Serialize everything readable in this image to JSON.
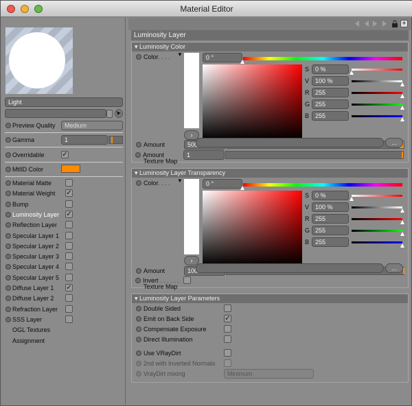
{
  "window": {
    "title": "Material Editor"
  },
  "left": {
    "name": "Light",
    "preview_quality": {
      "label": "Preview Quality",
      "value": "Medium"
    },
    "gamma": {
      "label": "Gamma",
      "value": "1"
    },
    "overridable": {
      "label": "Overridable"
    },
    "mtlid": {
      "label": "MtlID Color",
      "color": "#ff8a00"
    },
    "channels": [
      {
        "label": "Material Matte",
        "checked": false
      },
      {
        "label": "Material Weight",
        "checked": true
      },
      {
        "label": "Bump",
        "checked": false
      },
      {
        "label": "Luminosity Layer",
        "checked": true,
        "active": true
      },
      {
        "label": "Reflection Layer",
        "checked": false
      },
      {
        "label": "Specular Layer 1",
        "checked": false
      },
      {
        "label": "Specular Layer 2",
        "checked": false
      },
      {
        "label": "Specular Layer 3",
        "checked": false
      },
      {
        "label": "Specular Layer 4",
        "checked": false
      },
      {
        "label": "Specular Layer 5",
        "checked": false
      },
      {
        "label": "Diffuse Layer 1",
        "checked": true
      },
      {
        "label": "Diffuse Layer 2",
        "checked": false
      },
      {
        "label": "Refraction Layer",
        "checked": false
      },
      {
        "label": "SSS Layer",
        "checked": false
      }
    ],
    "ogl": "OGL Textures",
    "assignment": "Assignment"
  },
  "right": {
    "title": "Luminosity Layer",
    "color_section": {
      "title": "Luminosity Color",
      "color_label": "Color",
      "hue": "0 °",
      "S": "0 %",
      "V": "100 %",
      "R": "255",
      "G": "255",
      "B": "255",
      "amount_label": "Amount",
      "amount": "500 %",
      "texture_label": "Texture Map",
      "amount2_label": "Amount",
      "amount2": "1",
      "more": "..."
    },
    "transp_section": {
      "title": "Luminosity Layer Transparency",
      "color_label": "Color",
      "hue": "0 °",
      "S": "0 %",
      "V": "100 %",
      "R": "255",
      "G": "255",
      "B": "255",
      "amount_label": "Amount",
      "amount": "100 %",
      "texture_label": "Texture Map",
      "invert_label": "Invert",
      "more": "..."
    },
    "params": {
      "title": "Luminosity Layer Parameters",
      "double_sided": "Double Sided",
      "emit_back": "Emit on Back Side",
      "compensate": "Compensate Exposure",
      "direct": "Direct Illumination",
      "use_vraydirt": "Use VRayDirt",
      "second_inverted": "2nd with Inverted Normals",
      "vraydirt_mixing": "VrayDirt mixing",
      "mixing_value": "Minimum"
    }
  },
  "colors": {
    "accent": "#ff8a00",
    "panel": "#8b8b8b",
    "header": "#6e6e6e"
  }
}
